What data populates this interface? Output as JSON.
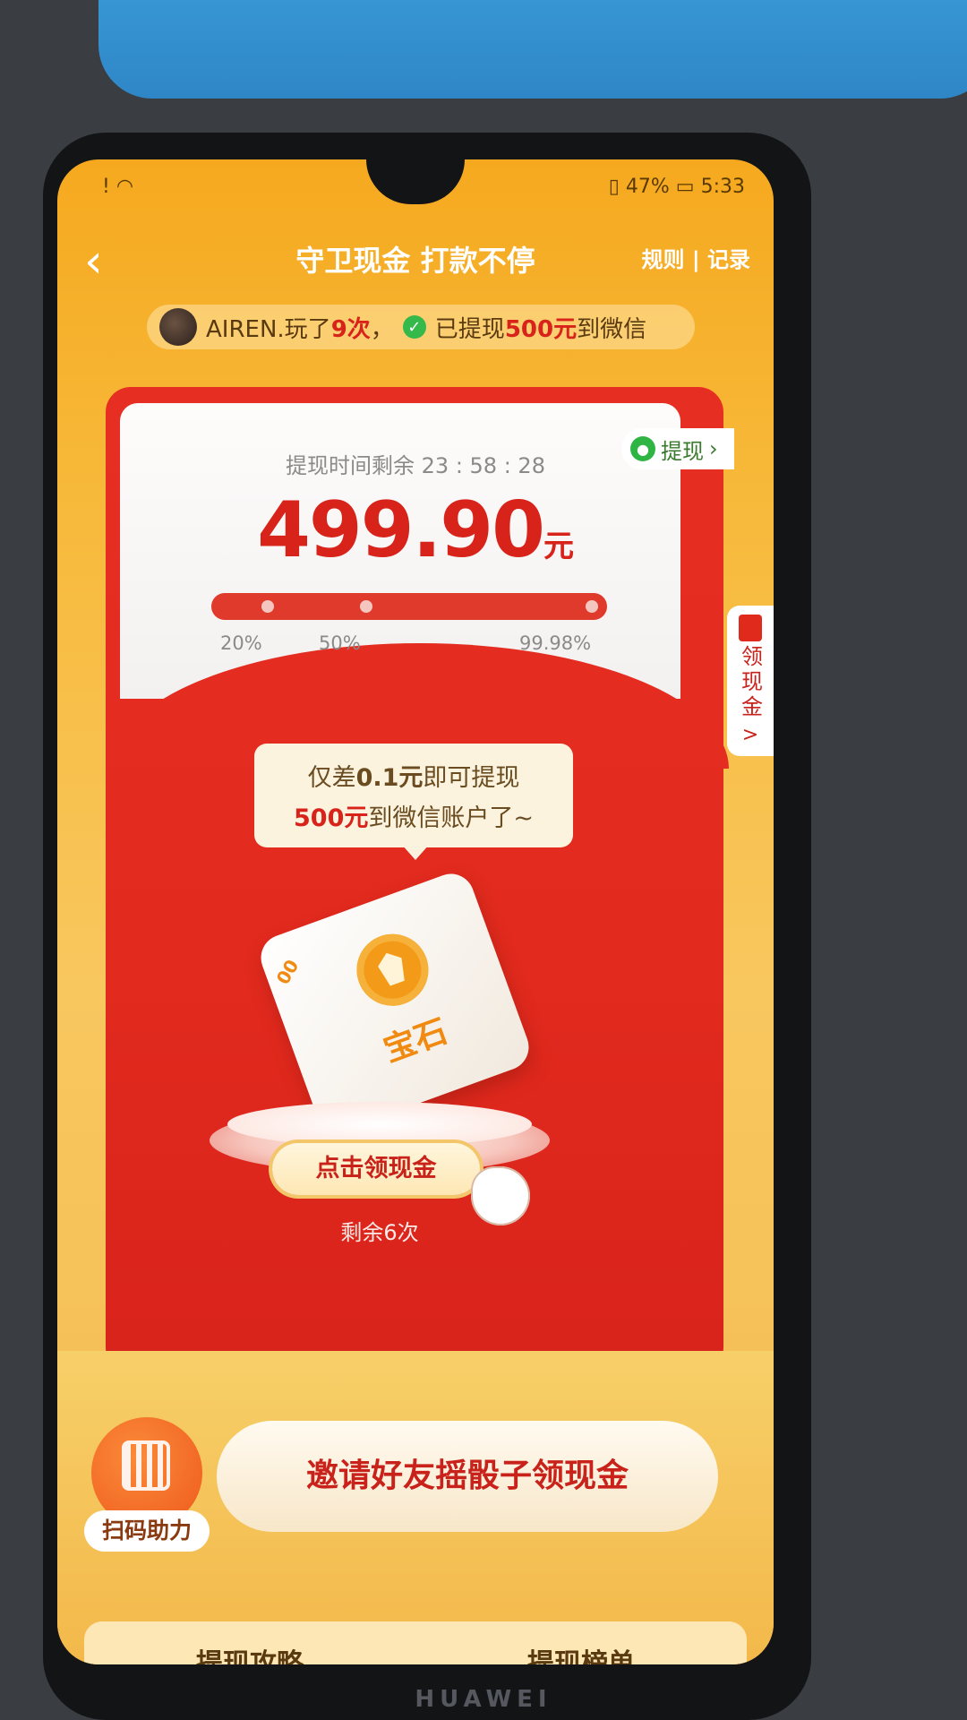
{
  "status_bar": {
    "left": "! ",
    "battery": "47%",
    "time": "5:33"
  },
  "header": {
    "title": "守卫现金 打款不停",
    "links": "规则 | 记录"
  },
  "notice": {
    "user": "AIREN.",
    "played_text": "玩了",
    "play_count": "9次",
    "comma": "，",
    "withdrawn_text": "已提现",
    "amount": "500元",
    "destination": "到微信"
  },
  "withdraw_button": {
    "label": "提现",
    "icon": "wechat-icon"
  },
  "card": {
    "timer_label": "提现时间剩余",
    "timer_value": "23 : 58 : 28",
    "amount": "499.90",
    "amount_unit": "元",
    "progress_labels": [
      "20%",
      "50%",
      "99.98%"
    ],
    "progress_value": 0.9998
  },
  "side_tab": {
    "label": "领现金",
    "arrow": ">"
  },
  "bubble": {
    "line1_prefix": "仅差",
    "line1_value": "0.1元",
    "line1_suffix": "即可提现",
    "line2_value": "500元",
    "line2_suffix": "到微信账户了~"
  },
  "dice": {
    "face_label": "宝石",
    "side_text": "00"
  },
  "claim_button": {
    "label": "点击领现金"
  },
  "remaining": "剩余6次",
  "actions": {
    "qr_label": "扫码助力",
    "invite_label": "邀请好友摇骰子领现金"
  },
  "bottom_tabs": [
    "提现攻略",
    "提现榜单"
  ],
  "brand": "HUAWEI",
  "colors": {
    "accent_red": "#d8231b",
    "orange": "#f6a91f"
  }
}
